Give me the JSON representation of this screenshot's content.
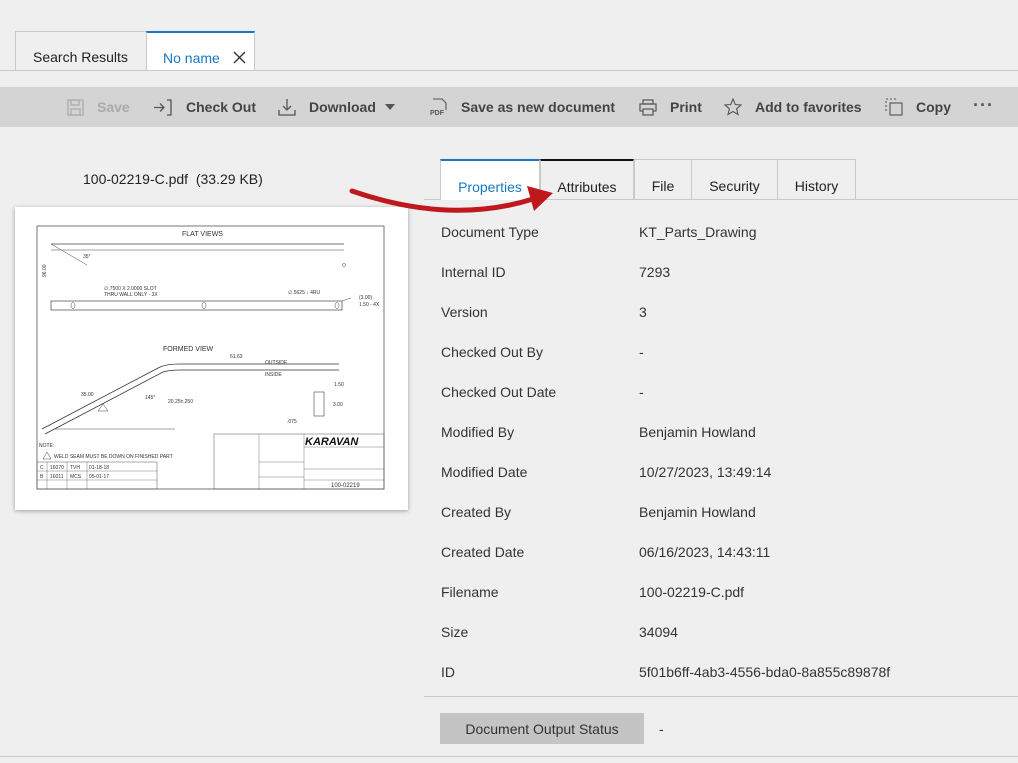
{
  "doc_tabs": {
    "search_results": "Search Results",
    "no_name": "No name"
  },
  "toolbar": {
    "save": "Save",
    "check_out": "Check Out",
    "download": "Download",
    "save_as_new": "Save as new document",
    "print": "Print",
    "add_to_favorites": "Add to favorites",
    "copy": "Copy",
    "more": "···"
  },
  "preview": {
    "file_name": "100-02219-C.pdf",
    "file_size": "(33.29 KB)",
    "drawing": {
      "flat_views": "FLAT VIEWS",
      "formed_view": "FORMED VIEW",
      "outside": "OUTSIDE",
      "inside": "INSIDE",
      "note": "NOTE:",
      "weld_note": "WELD SEAM MUST BE DOWN ON FINISHED PART",
      "brand": "KARAVAN",
      "part_number": "100-02219",
      "dim_slot": "∅.7500 X 2.0000 SLOT",
      "dim_wall": "THRU WALL ONLY - 3X",
      "dim_hole": "∅.5625 ↓ 4RU",
      "dim_6163": "61.63",
      "dim_35": "35.00",
      "dim_145": "145°",
      "dim_2025": "20.25±.250",
      "dim_150": "1.50",
      "dim_300": "3.00",
      "dim_075": ".075",
      "dim_35deg": "35°",
      "dim_9600": "96.00",
      "rev_c": "C",
      "rev_b": "B",
      "eco_c": "16070",
      "eco_b": "16011",
      "by_c": "TVH",
      "by_b": "MCS",
      "date_c": "01-18-18",
      "date_b": "05-01-17"
    }
  },
  "prop_tabs": [
    "Properties",
    "Attributes",
    "File",
    "Security",
    "History"
  ],
  "properties": [
    {
      "key": "Document Type",
      "value": "KT_Parts_Drawing"
    },
    {
      "key": "Internal ID",
      "value": "7293"
    },
    {
      "key": "Version",
      "value": "3"
    },
    {
      "key": "Checked Out By",
      "value": "-"
    },
    {
      "key": "Checked Out Date",
      "value": "-"
    },
    {
      "key": "Modified By",
      "value": "Benjamin Howland"
    },
    {
      "key": "Modified Date",
      "value": "10/27/2023, 13:49:14"
    },
    {
      "key": "Created By",
      "value": "Benjamin Howland"
    },
    {
      "key": "Created Date",
      "value": "06/16/2023, 14:43:11"
    },
    {
      "key": "Filename",
      "value": "100-02219-C.pdf"
    },
    {
      "key": "Size",
      "value": "34094"
    },
    {
      "key": "ID",
      "value": "5f01b6ff-4ab3-4556-bda0-8a855c89878f"
    }
  ],
  "output_status": {
    "label": "Document Output Status",
    "value": "-"
  },
  "colors": {
    "accent": "#1a78c2",
    "annotation_arrow": "#c0191d"
  }
}
